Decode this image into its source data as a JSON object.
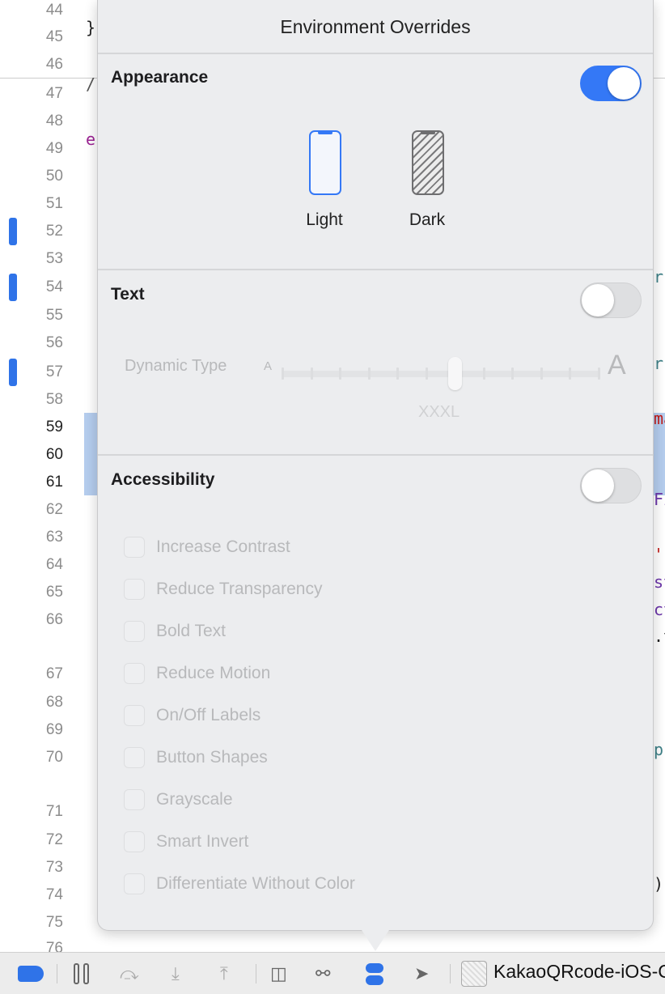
{
  "editor": {
    "line_numbers": [
      "44",
      "45",
      "46",
      "47",
      "48",
      "49",
      "50",
      "51",
      "52",
      "53",
      "54",
      "55",
      "56",
      "57",
      "58",
      "59",
      "60",
      "61",
      "62",
      "63",
      "64",
      "65",
      "66",
      "67",
      "68",
      "69",
      "70",
      "71",
      "72",
      "73",
      "74",
      "75",
      "76"
    ],
    "current_lines": [
      "59",
      "60",
      "61"
    ],
    "breakpoint_lines": [
      "52",
      "54",
      "57"
    ],
    "code_fragments": [
      {
        "text": "}",
        "color": "#222222"
      },
      {
        "text": "/",
        "color": "#555555"
      },
      {
        "text": "e",
        "color": "#9b2393"
      },
      {
        "text": "r",
        "color": "#3e8087"
      },
      {
        "text": "r",
        "color": "#3e8087"
      },
      {
        "text": "ma",
        "color": "#c41a16"
      },
      {
        "text": "Fi",
        "color": "#6c36a9"
      },
      {
        "text": "'",
        "color": "#c41a16"
      },
      {
        "text": "st",
        "color": "#6c36a9"
      },
      {
        "text": "ct",
        "color": "#6c36a9"
      },
      {
        "text": ".t",
        "color": "#222222"
      },
      {
        "text": "p",
        "color": "#3e8087"
      },
      {
        "text": ")",
        "color": "#222222"
      }
    ]
  },
  "popover": {
    "title": "Environment Overrides",
    "appearance": {
      "label": "Appearance",
      "enabled": true,
      "options": [
        "Light",
        "Dark"
      ],
      "selected": "Light"
    },
    "text": {
      "label": "Text",
      "enabled": false,
      "slider_label": "Dynamic Type",
      "small_glyph": "A",
      "large_glyph": "A",
      "value": "XXXL",
      "steps": 12,
      "selected_index": 6
    },
    "accessibility": {
      "label": "Accessibility",
      "enabled": false,
      "options": [
        "Increase Contrast",
        "Reduce Transparency",
        "Bold Text",
        "Reduce Motion",
        "On/Off Labels",
        "Button Shapes",
        "Grayscale",
        "Smart Invert",
        "Differentiate Without Color"
      ]
    }
  },
  "toolbar": {
    "icons": [
      "breakpoints-icon",
      "pause-icon",
      "step-over-icon",
      "step-into-icon",
      "step-out-icon",
      "view-hierarchy-icon",
      "memory-graph-icon",
      "environment-overrides-icon",
      "location-icon"
    ],
    "scheme": "KakaoQRcode-iOS-C",
    "accent": "#2f73e8"
  }
}
